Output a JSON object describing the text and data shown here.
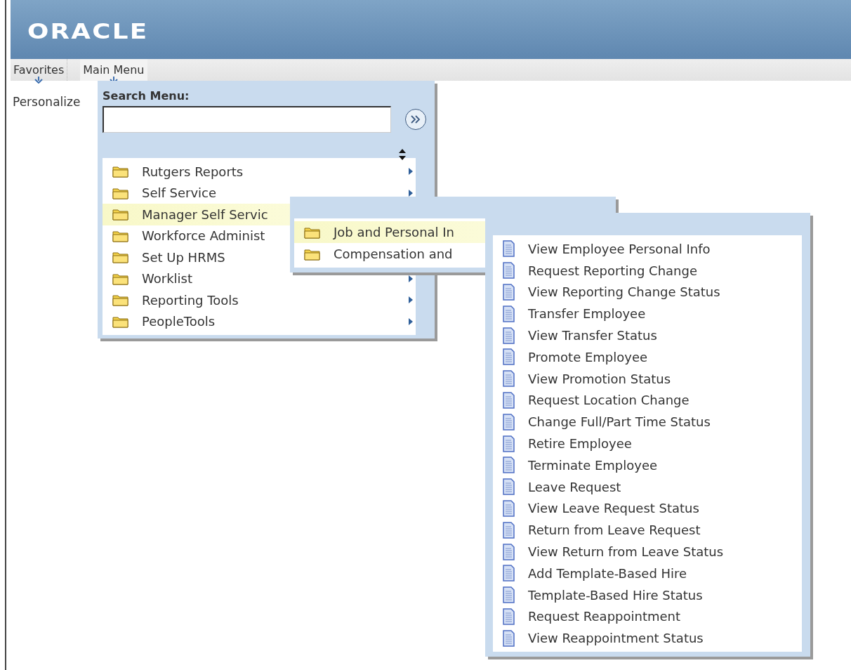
{
  "header": {
    "logo": "ORACLE"
  },
  "menubar": {
    "items": [
      {
        "label": "Favorites",
        "selected": false
      },
      {
        "label": "Main Menu",
        "selected": true
      }
    ]
  },
  "page": {
    "link": "Personalize"
  },
  "main_menu": {
    "search_label": "Search Menu:",
    "items": [
      {
        "kind": "folder",
        "label": "Rutgers Reports",
        "selected": false,
        "arrow": true
      },
      {
        "kind": "folder",
        "label": "Self Service",
        "selected": false,
        "arrow": true
      },
      {
        "kind": "folder",
        "label": "Manager Self Servic",
        "selected": true
      },
      {
        "kind": "folder",
        "label": "Workforce Administ",
        "selected": false
      },
      {
        "kind": "folder",
        "label": "Set Up HRMS",
        "selected": false
      },
      {
        "kind": "folder",
        "label": "Worklist",
        "selected": false,
        "arrow": true
      },
      {
        "kind": "folder",
        "label": "Reporting Tools",
        "selected": false,
        "arrow": true
      },
      {
        "kind": "folder",
        "label": "PeopleTools",
        "selected": false,
        "arrow": true
      }
    ]
  },
  "submenu": {
    "items": [
      {
        "kind": "folder",
        "label": "Job and Personal In",
        "selected": true
      },
      {
        "kind": "folder",
        "label": "Compensation and",
        "selected": false
      }
    ]
  },
  "pages_menu": {
    "items": [
      {
        "kind": "page",
        "label": "View Employee Personal Info",
        "selected": false
      },
      {
        "kind": "page",
        "label": "Request Reporting Change",
        "selected": false
      },
      {
        "kind": "page",
        "label": "View Reporting Change Status",
        "selected": false
      },
      {
        "kind": "page",
        "label": "Transfer Employee",
        "selected": false
      },
      {
        "kind": "page",
        "label": "View Transfer Status",
        "selected": false
      },
      {
        "kind": "page",
        "label": "Promote Employee",
        "selected": false
      },
      {
        "kind": "page",
        "label": "View Promotion Status",
        "selected": false
      },
      {
        "kind": "page",
        "label": "Request Location Change",
        "selected": false
      },
      {
        "kind": "page",
        "label": "Change Full/Part Time Status",
        "selected": false
      },
      {
        "kind": "page",
        "label": "Retire Employee",
        "selected": false
      },
      {
        "kind": "page",
        "label": "Terminate Employee",
        "selected": false
      },
      {
        "kind": "page",
        "label": "Leave Request",
        "selected": false
      },
      {
        "kind": "page",
        "label": "View Leave Request Status",
        "selected": false
      },
      {
        "kind": "page",
        "label": "Return from Leave Request",
        "selected": false
      },
      {
        "kind": "page",
        "label": "View Return from Leave Status",
        "selected": false
      },
      {
        "kind": "page",
        "label": "Add Template-Based Hire",
        "selected": false
      },
      {
        "kind": "page",
        "label": "Template-Based Hire Status",
        "selected": false
      },
      {
        "kind": "page",
        "label": "Request Reappointment",
        "selected": false
      },
      {
        "kind": "page",
        "label": "View Reappointment Status",
        "selected": false
      }
    ]
  }
}
